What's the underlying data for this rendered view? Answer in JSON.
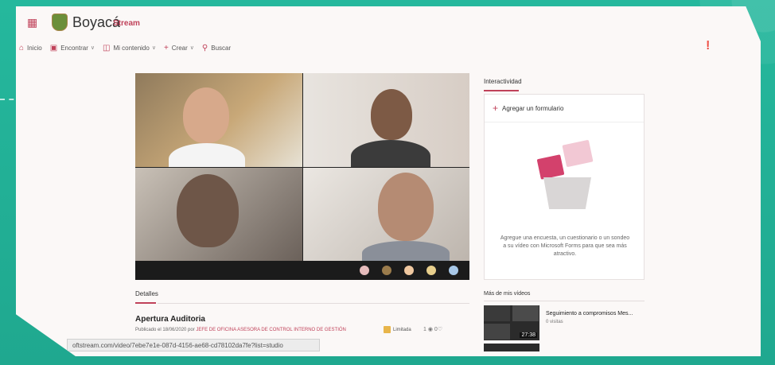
{
  "header": {
    "org_name": "Boyacá",
    "app_name": "Stream"
  },
  "nav": {
    "items": [
      {
        "label": "Inicio",
        "icon": "home-icon"
      },
      {
        "label": "Encontrar",
        "icon": "find-icon"
      },
      {
        "label": "Mi contenido",
        "icon": "content-icon"
      },
      {
        "label": "Crear",
        "icon": "plus-icon"
      },
      {
        "label": "Buscar",
        "icon": "search-icon"
      }
    ]
  },
  "video": {
    "details_tab": "Detalles",
    "title": "Apertura Auditoria",
    "published_prefix": "Publicado el 18/06/2020 por",
    "author": "JEFE DE OFICINA ASESORA DE CONTROL INTERNO DE GESTIÓN",
    "visibility": "Limitada",
    "views": "1",
    "likes": "0"
  },
  "interactivity": {
    "tab": "Interactividad",
    "add_form": "Agregar un formulario",
    "description": "Agregue una encuesta, un cuestionario o un sondeo a su vídeo con Microsoft Forms para que sea más atractivo."
  },
  "more_videos": {
    "label": "Más de mis vídeos",
    "items": [
      {
        "title": "Seguimiento a compromisos Mes...",
        "views": "0 visitas",
        "duration": "27:38"
      }
    ]
  },
  "status_url": "oftstream.com/video/7ebe7e1e-087d-4156-ae68-cd78102da7fe?list=studio",
  "colors": {
    "accent": "#c0425a",
    "background": "#22b49a"
  }
}
